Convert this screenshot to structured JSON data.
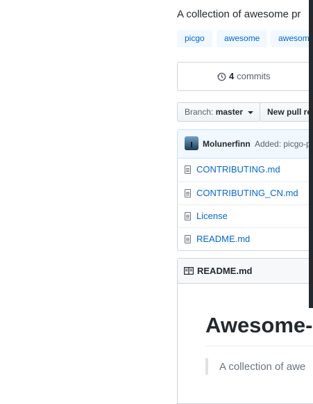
{
  "repo": {
    "description": "A collection of awesome pr",
    "topics": [
      "picgo",
      "awesome",
      "awesome"
    ]
  },
  "summary": {
    "commits_count": "4",
    "commits_label": "commits"
  },
  "toolbar": {
    "branch_label": "Branch:",
    "branch_value": "master",
    "new_pr_label": "New pull re"
  },
  "commit": {
    "author": "Molunerfinn",
    "message": "Added: picgo-p"
  },
  "files": [
    {
      "name": "CONTRIBUTING.md",
      "icon": "file-icon"
    },
    {
      "name": "CONTRIBUTING_CN.md",
      "icon": "file-icon"
    },
    {
      "name": "License",
      "icon": "file-icon"
    },
    {
      "name": "README.md",
      "icon": "file-icon"
    }
  ],
  "readme": {
    "title": "README.md",
    "heading": "Awesome-",
    "quote": "A collection of awe"
  },
  "colors": {
    "link": "#0366d6",
    "topic_bg": "#f1f8ff",
    "text": "#24292e"
  }
}
